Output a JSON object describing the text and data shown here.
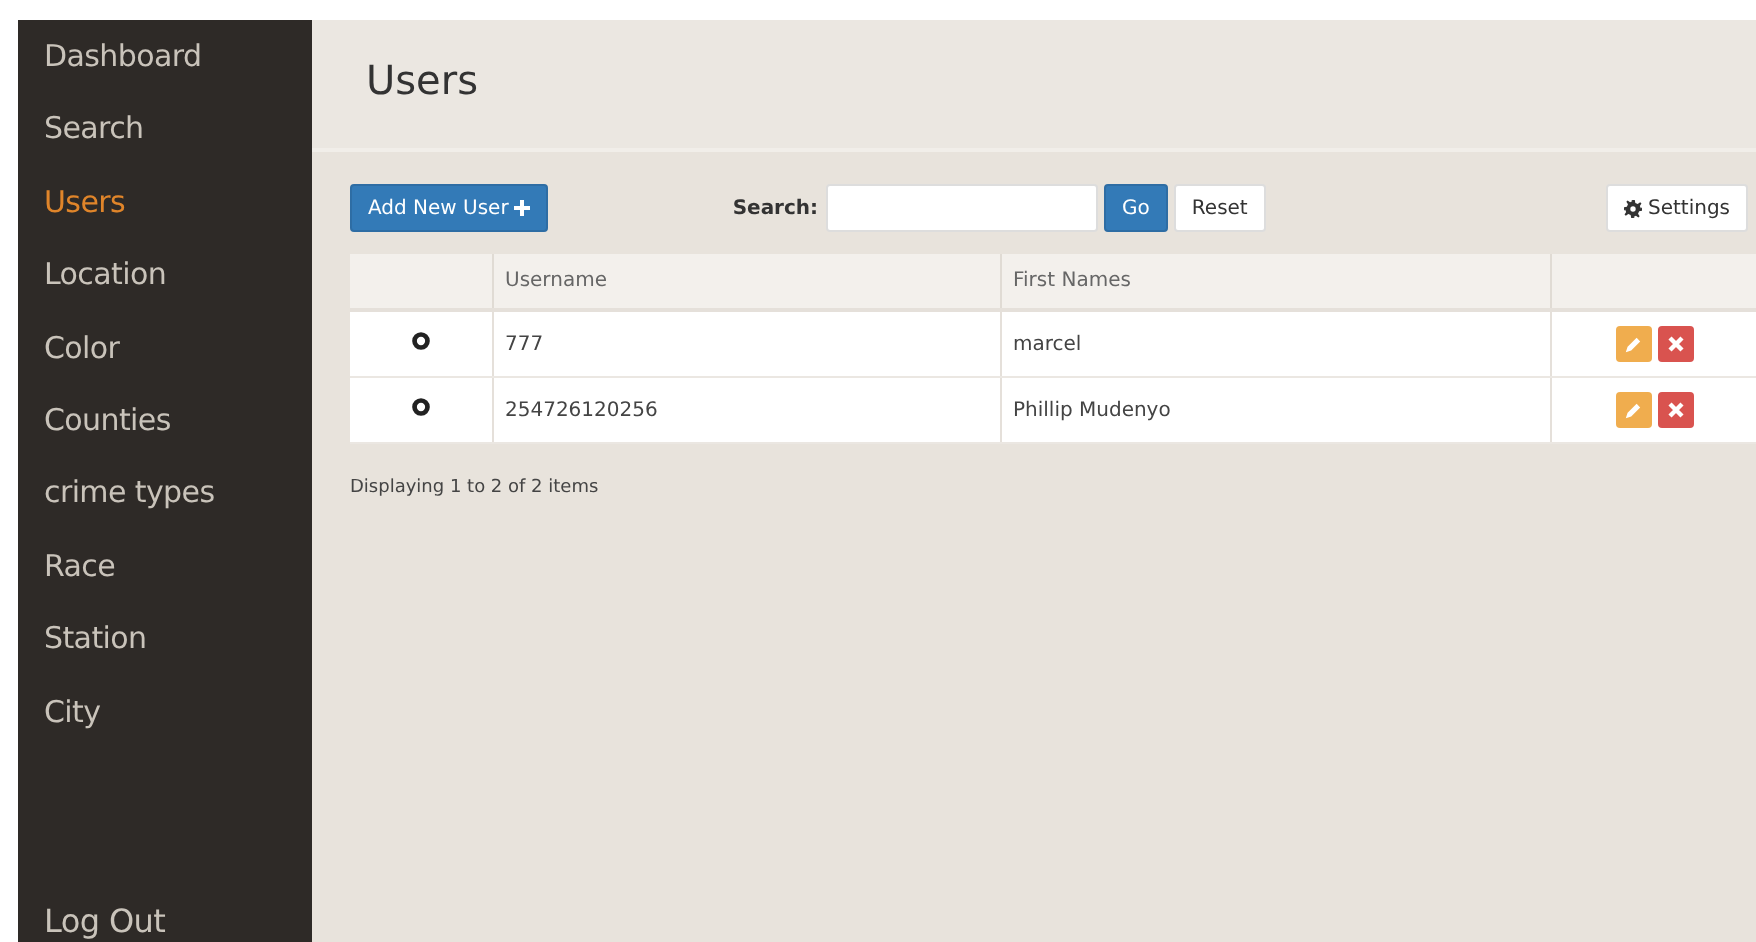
{
  "sidebar": {
    "items": [
      {
        "label": "Dashboard",
        "selected": false
      },
      {
        "label": "Search",
        "selected": false
      },
      {
        "label": "Users",
        "selected": true
      },
      {
        "label": "Location",
        "selected": false
      },
      {
        "label": "Color",
        "selected": false
      },
      {
        "label": "Counties",
        "selected": false
      },
      {
        "label": "crime types",
        "selected": false
      },
      {
        "label": "Race",
        "selected": false
      },
      {
        "label": "Station",
        "selected": false
      },
      {
        "label": "City",
        "selected": false
      }
    ],
    "footer": "Log Out"
  },
  "page": {
    "title": "Users"
  },
  "toolbar": {
    "add_button": "Add New User",
    "search_label": "Search:",
    "go_button": "Go",
    "reset_button": "Reset",
    "settings_button": "Settings"
  },
  "table": {
    "columns": [
      "Username",
      "First Names"
    ],
    "rows": [
      {
        "username": "777",
        "first_names": "marcel"
      },
      {
        "username": "254726120256",
        "first_names": "Phillip Mudenyo"
      }
    ]
  },
  "pager": "Displaying 1 to 2 of 2 items"
}
